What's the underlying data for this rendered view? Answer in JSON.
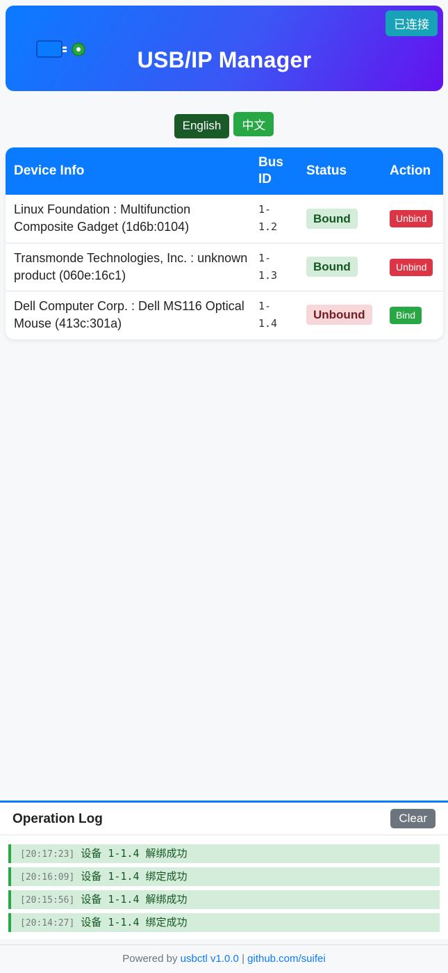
{
  "header": {
    "title": "USB/IP Manager",
    "connection_status": "已连接",
    "logo_icon": "usb-icon",
    "accent_from": "#0a7bff",
    "accent_to": "#6412ee"
  },
  "language": {
    "english": "English",
    "chinese": "中文"
  },
  "table": {
    "columns": {
      "device_info": "Device Info",
      "bus_id": "Bus ID",
      "status": "Status",
      "action": "Action"
    },
    "rows": [
      {
        "device": "Linux Foundation : Multifunction Composite Gadget (1d6b:0104)",
        "bus_id": "1-1.2",
        "status": "Bound",
        "action": "Unbind"
      },
      {
        "device": "Transmonde Technologies, Inc. : unknown product (060e:16c1)",
        "bus_id": "1-1.3",
        "status": "Bound",
        "action": "Unbind"
      },
      {
        "device": "Dell Computer Corp. : Dell MS116 Optical Mouse (413c:301a)",
        "bus_id": "1-1.4",
        "status": "Unbound",
        "action": "Bind"
      }
    ]
  },
  "log": {
    "title": "Operation Log",
    "clear_label": "Clear",
    "entries": [
      {
        "time": "[20:17:23]",
        "message": "设备 1-1.4 解绑成功"
      },
      {
        "time": "[20:16:09]",
        "message": "设备 1-1.4 绑定成功"
      },
      {
        "time": "[20:15:56]",
        "message": "设备 1-1.4 解绑成功"
      },
      {
        "time": "[20:14:27]",
        "message": "设备 1-1.4 绑定成功"
      }
    ]
  },
  "footer": {
    "prefix": "Powered by",
    "product_link": "usbctl v1.0.0",
    "separator": "|",
    "repo_link": "github.com/suifei"
  }
}
